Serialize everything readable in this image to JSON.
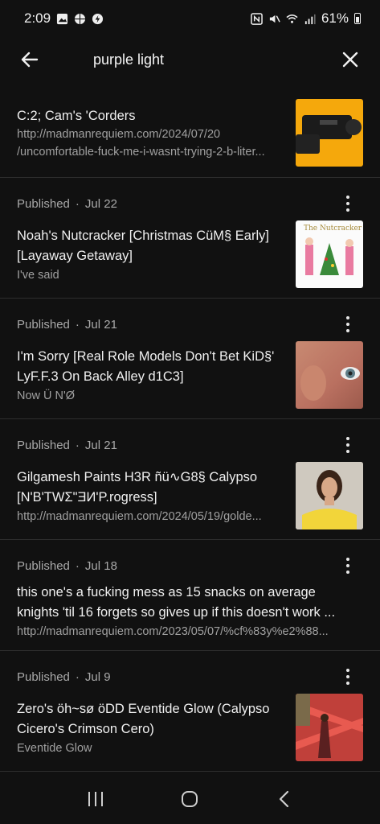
{
  "status_bar": {
    "time": "2:09",
    "battery": "61%"
  },
  "search": {
    "query": "purple light"
  },
  "first_item": {
    "title": "C:2; Cam's 'Corders",
    "sub_line1": "http://madmanrequiem.com/2024/07/20",
    "sub_line2": "/uncomfortable-fuck-me-i-wasnt-trying-2-b-liter..."
  },
  "items": [
    {
      "status": "Published",
      "dot": "·",
      "date": "Jul 22",
      "title": "Noah's Nutcracker [Christmas CüM§ Early] [Layaway Getaway]",
      "sub": "I've said",
      "thumb_text": "The Nutcracker"
    },
    {
      "status": "Published",
      "dot": "·",
      "date": "Jul 21",
      "title": "I'm Sorry [Real Role Models Don't Bet KiD§' LyF.F.3 On Back Alley d1C3]",
      "sub": "Now Ü N'Ø"
    },
    {
      "status": "Published",
      "dot": "·",
      "date": "Jul 21",
      "title": "Gilgamesh Paints H3R ñü∿G8§ Calypso [N'B'TWΣ\"ƎИ'P.rogress]",
      "sub": "http://madmanrequiem.com/2024/05/19/golde..."
    },
    {
      "status": "Published",
      "dot": "·",
      "date": "Jul 18",
      "title": "this one's a fucking mess as 15 snacks on average knights 'til 16 forgets so gives up if this doesn't work ...",
      "sub": "http://madmanrequiem.com/2023/05/07/%cf%83y%e2%88..."
    },
    {
      "status": "Published",
      "dot": "·",
      "date": "Jul 9",
      "title": "Zero's öh~sø öDD Eventide Glow (Calypso Cicero's Crimson Cero)",
      "sub": "Eventide Glow"
    }
  ]
}
